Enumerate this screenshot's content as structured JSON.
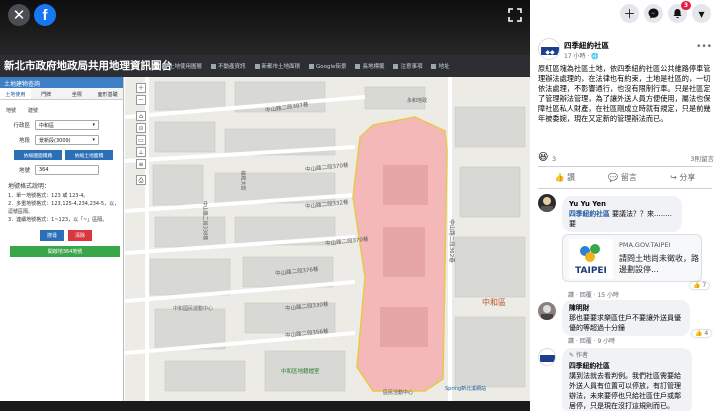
{
  "viewer": {
    "close_icon": "✕",
    "fb_logo": "f"
  },
  "gis": {
    "title": "新北市政府地政局共用地理資訊圖台",
    "nav": [
      "土地使用圖層",
      "不動產資訊",
      "新都市土地面積",
      "Google街景",
      "長地標籤",
      "注意事項",
      "地址"
    ],
    "panel": {
      "header": "土地建物查詢",
      "tabs": [
        "土地使用",
        "門牌",
        "坐標",
        "面形基礎"
      ],
      "subtabs": [
        "地號",
        "建號"
      ],
      "district_label": "行政區",
      "district_value": "中和區",
      "section_label": "地段",
      "section_value": "景新段(3009)",
      "btn_left": "依縮圖面積路",
      "btn_right": "依縮土地面積",
      "lot_label": "地號",
      "lot_value": "364",
      "notes_title": "地號格式說明：",
      "notes": [
        "1．單一地號格式：123 或 123-4。",
        "2．多重地號格式：123,125-4,234,234-5，以，逗號區隔。",
        "3．連續地號格式：1~123，以「~」區隔。"
      ],
      "search_btn": "搜尋",
      "clear_btn": "清除",
      "green_btn": "開啟地364地號"
    },
    "map_labels": [
      "中山路二段387巷",
      "中山路二段370巷",
      "中山路二段332巷",
      "中山路二段370巷",
      "中山路二段376巷",
      "中山路二段330巷",
      "中山路二段356巷",
      "中山路二段362巷",
      "中和區",
      "中和區地籍檔室",
      "中和國民運動中心",
      "Spring新北溪網站",
      "中山路二段338巷",
      "福和大街",
      "區民活動中心",
      "永和地政"
    ]
  },
  "side": {
    "top_icons": [
      "plus-icon",
      "messenger-icon",
      "bell-icon",
      "chevron-down-icon"
    ],
    "notif_count": "3",
    "post": {
      "page_name": "四季紐約社區",
      "time": "17 小時 · 🌐",
      "text": "原紅區塊為社區土地，依四季紐約社區公共維路停車管理辦法處理的，在法律也有約束，土地是社區的，一切依法處理，不影響通行，也沒有限制行車。只是社區定了管理辦法管理，為了讓外送人員方便使用，屬法也保障社區私人財產，在社區剛成立時就有規定，只是前幾年被委婉，現在又定新的管理辦法而已。",
      "reaction_count": "3",
      "shares": "3則留言",
      "actions": [
        "讚",
        "留言",
        "分享"
      ]
    },
    "comments": [
      {
        "name": "Yu Yu Yen",
        "mention": "四季紐約社區",
        "text": "要議法？？來........要",
        "link_domain": "PMA.GOV.TAIPEI",
        "link_text": "請問土地尚未徵收，路邊劃設停...",
        "meta": "讚 · 回覆 · 15 小時",
        "likes": "7"
      },
      {
        "name": "陳明財",
        "text": "那也要要求樂區住戶不要讓外送員優優的等超過十分鐘",
        "meta": "讚 · 回覆 · 9 小時",
        "likes": "4"
      },
      {
        "name": "四季紐約社區",
        "author_tag": "作者",
        "text": "講到法就去看判例。我們社區需要給外送人員有位置可以停放，有訂管理辦法，未來要停也只給社區住戶或鄰居停，只是現在沒打這規則而已。"
      }
    ]
  },
  "colors": {
    "fb_blue": "#1877f2",
    "parcel_fill": "#f4b8b8",
    "parcel_border": "#e8c84a",
    "gis_blue": "#2b6fb6",
    "gis_green": "#3aa64a",
    "gis_red": "#d9363e"
  }
}
